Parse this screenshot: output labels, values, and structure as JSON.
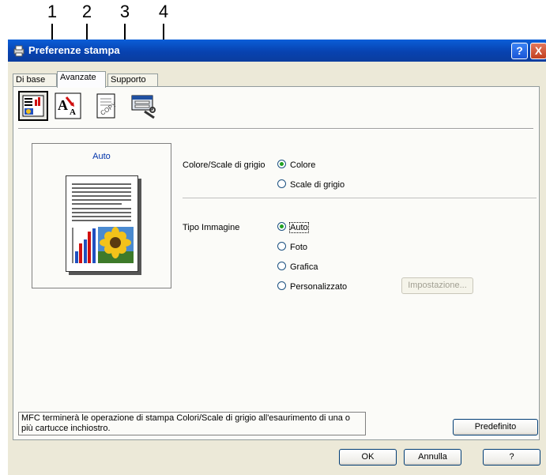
{
  "callouts": [
    "1",
    "2",
    "3",
    "4"
  ],
  "window": {
    "title": "Preferenze stampa",
    "help_button": "?",
    "close_button": "X"
  },
  "tabs": [
    {
      "label": "Di base"
    },
    {
      "label": "Avanzate"
    },
    {
      "label": "Supporto"
    }
  ],
  "toolbar_icons": [
    "color-quality-icon",
    "font-scaling-icon",
    "copy-watermark-icon",
    "device-options-icon"
  ],
  "preview": {
    "label": "Auto"
  },
  "color_mode": {
    "label": "Colore/Scale di grigio",
    "options": [
      "Colore",
      "Scale di grigio"
    ],
    "selected": "Colore"
  },
  "image_type": {
    "label": "Tipo Immagine",
    "options": [
      "Auto",
      "Foto",
      "Grafica",
      "Personalizzato"
    ],
    "selected": "Auto"
  },
  "settings_button": "Impostazione...",
  "note": "MFC terminerà le operazione di stampa Colori/Scale di grigio all'esaurimento di una o più cartucce inchiostro.",
  "default_button": "Predefinito",
  "footer": {
    "ok": "OK",
    "cancel": "Annulla",
    "help": "?"
  },
  "colors": {
    "titlebar": "#0842b0",
    "dialog_bg": "#ece9d8",
    "radio_dot": "#21a121",
    "preview_label": "#0033aa"
  }
}
